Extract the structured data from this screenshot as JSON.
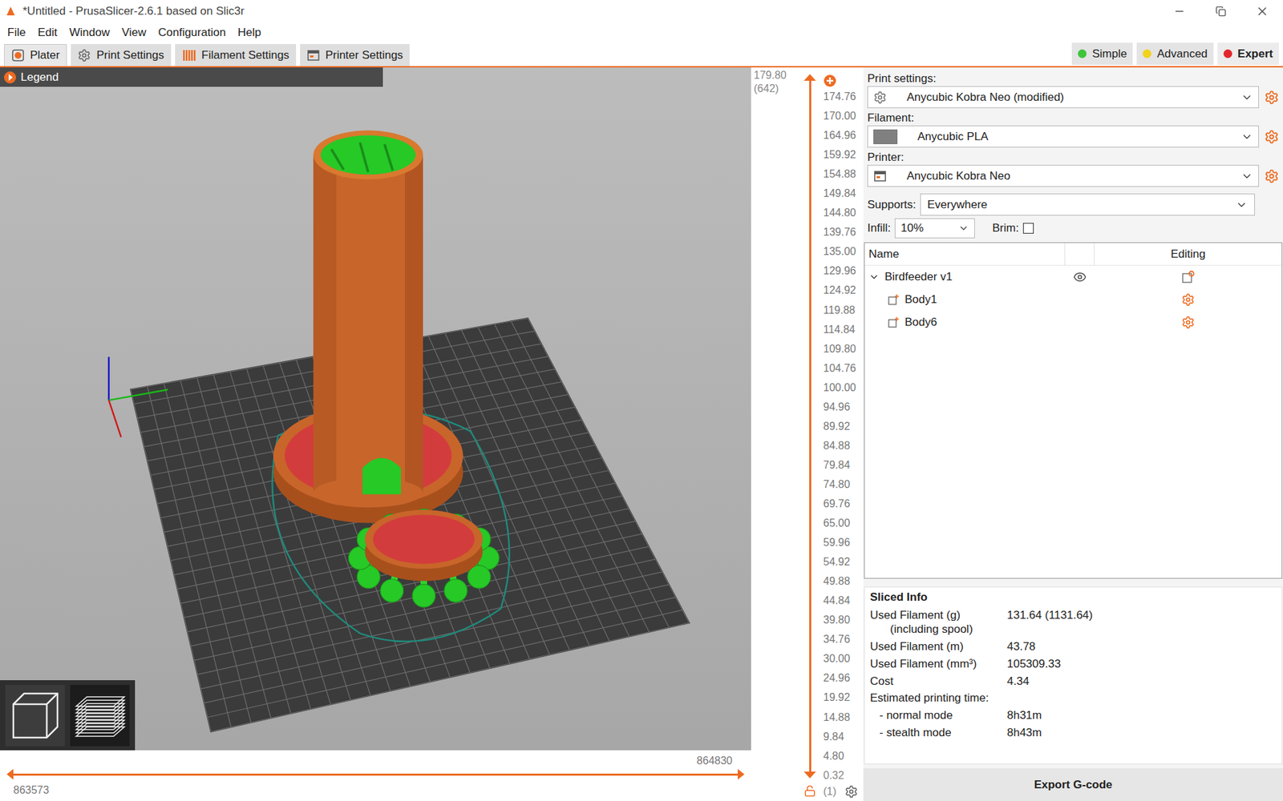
{
  "window": {
    "title": "*Untitled - PrusaSlicer-2.6.1 based on Slic3r"
  },
  "menu": [
    "File",
    "Edit",
    "Window",
    "View",
    "Configuration",
    "Help"
  ],
  "tabs": [
    {
      "label": "Plater",
      "selected": true,
      "kind": "plater"
    },
    {
      "label": "Print Settings",
      "selected": false,
      "kind": "print"
    },
    {
      "label": "Filament Settings",
      "selected": false,
      "kind": "filament"
    },
    {
      "label": "Printer Settings",
      "selected": false,
      "kind": "printer"
    }
  ],
  "modes": [
    {
      "label": "Simple",
      "selected": false,
      "color": "#3fc43a"
    },
    {
      "label": "Advanced",
      "selected": false,
      "color": "#f2d21b"
    },
    {
      "label": "Expert",
      "selected": true,
      "color": "#e3262b"
    }
  ],
  "viewport": {
    "legend": "Legend",
    "view_buttons": [
      {
        "kind": "3d",
        "selected": false
      },
      {
        "kind": "preview",
        "selected": true
      }
    ]
  },
  "vertical_slider": {
    "upper_value": "179.80",
    "upper_layer": "(642)",
    "ticks": [
      "174.76",
      "170.00",
      "164.96",
      "159.92",
      "154.88",
      "149.84",
      "144.80",
      "139.76",
      "135.00",
      "129.96",
      "124.92",
      "119.88",
      "114.84",
      "109.80",
      "104.76",
      "100.00",
      "94.96",
      "89.92",
      "84.88",
      "79.84",
      "74.80",
      "69.76",
      "65.00",
      "59.96",
      "54.92",
      "49.88",
      "44.84",
      "39.80",
      "34.76",
      "30.00",
      "24.96",
      "19.92",
      "14.88",
      "9.84",
      "4.80"
    ],
    "lower_value": "0.32",
    "lower_layer": "(1)"
  },
  "horizontal_slider": {
    "upper_value": "864830",
    "lower_value": "863573"
  },
  "settings": {
    "print": {
      "label": "Print settings:",
      "value": "Anycubic Kobra Neo (modified)"
    },
    "filament": {
      "label": "Filament:",
      "value": "Anycubic PLA",
      "color": "#808080"
    },
    "printer": {
      "label": "Printer:",
      "value": "Anycubic Kobra Neo"
    },
    "supports": {
      "label": "Supports:",
      "value": "Everywhere"
    },
    "infill": {
      "label": "Infill:",
      "value": "10%"
    },
    "brim": {
      "label": "Brim:",
      "checked": false
    }
  },
  "objects": {
    "columns": [
      "Name",
      "Editing"
    ],
    "items": [
      {
        "name": "Birdfeeder v1",
        "kind": "object",
        "expanded": true,
        "visible": true
      },
      {
        "name": "Body1",
        "kind": "part"
      },
      {
        "name": "Body6",
        "kind": "part"
      }
    ]
  },
  "sliced_info": {
    "title": "Sliced Info",
    "rows": [
      {
        "kind": "row",
        "label": "Used Filament (g)",
        "sublabel": "(including spool)",
        "value": "131.64 (1131.64)"
      },
      {
        "kind": "row",
        "label": "Used Filament (m)",
        "sublabel": "",
        "value": "43.78"
      },
      {
        "kind": "row",
        "label": "Used Filament (mm³)",
        "sublabel": "",
        "value": "105309.33"
      },
      {
        "kind": "row",
        "label": "Cost",
        "sublabel": "",
        "value": "4.34"
      },
      {
        "kind": "header",
        "label": "Estimated printing time:",
        "sublabel": "",
        "value": ""
      },
      {
        "kind": "sub",
        "label": "- normal mode",
        "sublabel": "",
        "value": "8h31m"
      },
      {
        "kind": "sub",
        "label": "- stealth mode",
        "sublabel": "",
        "value": "8h43m"
      }
    ]
  },
  "export_button": "Export G-code"
}
